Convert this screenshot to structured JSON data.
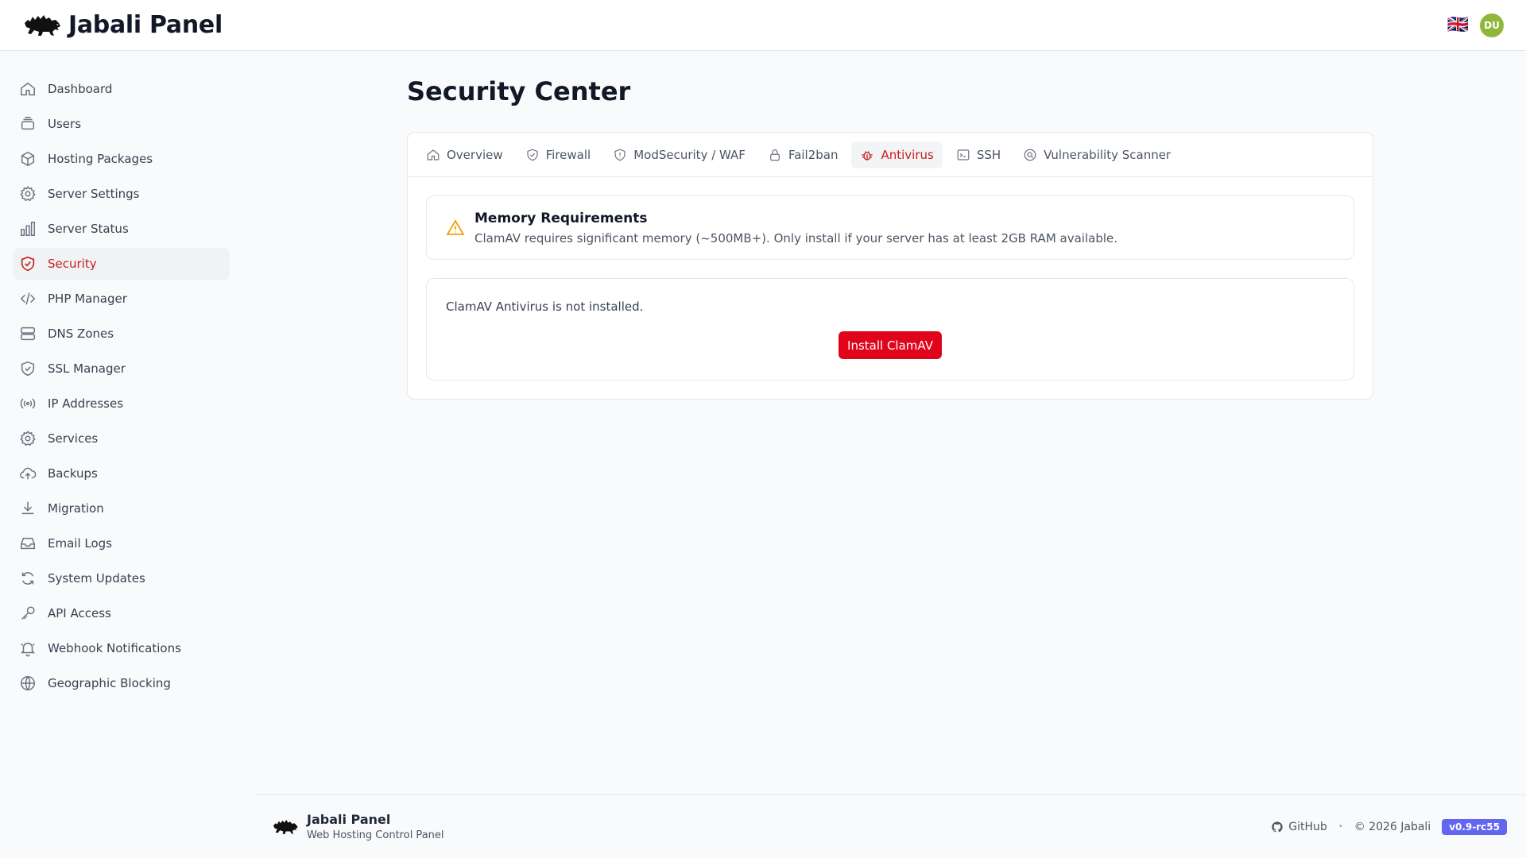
{
  "header": {
    "brand": "Jabali Panel",
    "flag": "🇬🇧",
    "avatar_initials": "DU"
  },
  "sidebar": {
    "items": [
      {
        "label": "Dashboard",
        "icon": "home-icon"
      },
      {
        "label": "Users",
        "icon": "users-icon"
      },
      {
        "label": "Hosting Packages",
        "icon": "cube-icon"
      },
      {
        "label": "Server Settings",
        "icon": "gear-icon"
      },
      {
        "label": "Server Status",
        "icon": "bar-chart-icon"
      },
      {
        "label": "Security",
        "icon": "shield-check-icon",
        "active": true
      },
      {
        "label": "PHP Manager",
        "icon": "code-icon"
      },
      {
        "label": "DNS Zones",
        "icon": "server-icon"
      },
      {
        "label": "SSL Manager",
        "icon": "shield-icon"
      },
      {
        "label": "IP Addresses",
        "icon": "signal-icon"
      },
      {
        "label": "Services",
        "icon": "cog-icon"
      },
      {
        "label": "Backups",
        "icon": "cloud-upload-icon"
      },
      {
        "label": "Migration",
        "icon": "download-icon"
      },
      {
        "label": "Email Logs",
        "icon": "inbox-icon"
      },
      {
        "label": "System Updates",
        "icon": "refresh-icon"
      },
      {
        "label": "API Access",
        "icon": "key-icon"
      },
      {
        "label": "Webhook Notifications",
        "icon": "bell-icon"
      },
      {
        "label": "Geographic Blocking",
        "icon": "globe-icon"
      }
    ]
  },
  "main": {
    "title": "Security Center",
    "tabs": [
      {
        "label": "Overview",
        "icon": "home-icon"
      },
      {
        "label": "Firewall",
        "icon": "shield-check-icon"
      },
      {
        "label": "ModSecurity / WAF",
        "icon": "shield-exclamation-icon"
      },
      {
        "label": "Fail2ban",
        "icon": "lock-icon"
      },
      {
        "label": "Antivirus",
        "icon": "bug-icon",
        "active": true
      },
      {
        "label": "SSH",
        "icon": "terminal-icon"
      },
      {
        "label": "Vulnerability Scanner",
        "icon": "scan-icon"
      }
    ],
    "alert": {
      "title": "Memory Requirements",
      "text": "ClamAV requires significant memory (~500MB+). Only install if your server has at least 2GB RAM available.",
      "icon": "warning-triangle-icon"
    },
    "status": {
      "text": "ClamAV Antivirus is not installed.",
      "button_label": "Install ClamAV"
    }
  },
  "footer": {
    "title": "Jabali Panel",
    "subtitle": "Web Hosting Control Panel",
    "github_label": "GitHub",
    "separator": "•",
    "copyright": "© 2026 Jabali",
    "version": "v0.9-rc55"
  },
  "colors": {
    "accent": "#c81e1e",
    "button": "#e0041b",
    "warning": "#f59e0b",
    "version_badge": "#6366f1",
    "avatar": "#8fb83b"
  }
}
